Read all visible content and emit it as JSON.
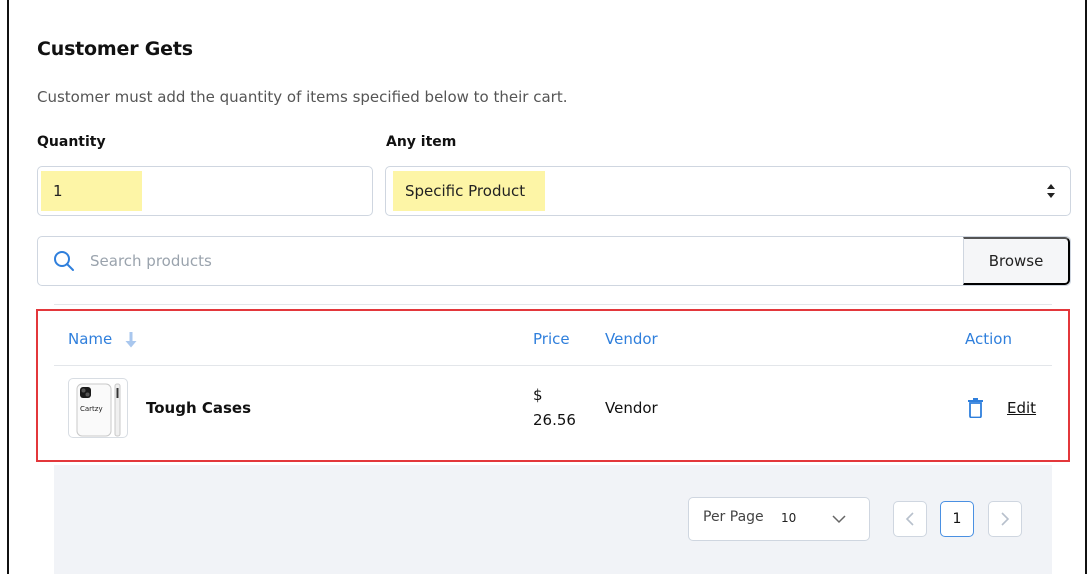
{
  "section": {
    "title": "Customer Gets",
    "description": "Customer must add the quantity of items specified below to their cart."
  },
  "quantity": {
    "label": "Quantity",
    "value": "1"
  },
  "item_type": {
    "label": "Any item",
    "selected": "Specific Product"
  },
  "search": {
    "placeholder": "Search products",
    "browse_label": "Browse"
  },
  "table": {
    "columns": {
      "name": "Name",
      "price": "Price",
      "vendor": "Vendor",
      "action": "Action"
    },
    "rows": [
      {
        "name": "Tough Cases",
        "price_currency": "$",
        "price_value": "26.56",
        "vendor": "Vendor",
        "edit_label": "Edit",
        "thumbnail_text": "Cartzy"
      }
    ]
  },
  "pagination": {
    "per_page_label": "Per Page",
    "per_page_value": "10",
    "current_page": "1"
  },
  "colors": {
    "accent": "#2f7fdc",
    "highlight": "#fdf5a6",
    "annotation": "#e3373b"
  },
  "icons": {
    "search": "search-icon",
    "sort": "arrow-down-icon",
    "trash": "trash-icon",
    "chevron_down": "chevron-down-icon",
    "chevron_left": "chevron-left-icon",
    "chevron_right": "chevron-right-icon",
    "select_caret": "sort-caret-icon"
  }
}
